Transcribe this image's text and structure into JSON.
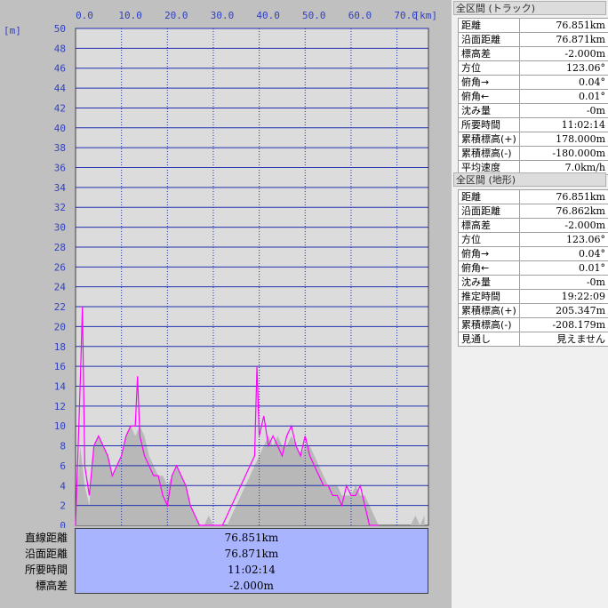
{
  "chart_data": {
    "type": "area",
    "x_unit": "[km]",
    "y_unit": "[m]",
    "x_ticks": [
      "0.0",
      "10.0",
      "20.0",
      "30.0",
      "40.0",
      "50.0",
      "60.0",
      "70.0"
    ],
    "y_ticks": [
      "0",
      "2",
      "4",
      "6",
      "8",
      "10",
      "12",
      "14",
      "16",
      "18",
      "20",
      "22",
      "24",
      "26",
      "28",
      "30",
      "32",
      "34",
      "36",
      "38",
      "40",
      "42",
      "44",
      "46",
      "48",
      "50"
    ],
    "xlim": [
      0,
      76.851
    ],
    "ylim": [
      0,
      50
    ],
    "grid": true,
    "colors": {
      "terrain": "#b8b8b8",
      "track": "#ff00ff",
      "grid": "#2030b0",
      "plot_bg": "#dcdcdc"
    },
    "series": [
      {
        "x": [
          0,
          1,
          2,
          3,
          4,
          5,
          6,
          7,
          8,
          9,
          10,
          11,
          12,
          13,
          14,
          15,
          16,
          17,
          18,
          19,
          20,
          21,
          22,
          23,
          24,
          25,
          26,
          27,
          28,
          29,
          30,
          31,
          32,
          33,
          34,
          35,
          36,
          37,
          38,
          39,
          40,
          41,
          42,
          43,
          44,
          45,
          46,
          47,
          48,
          49,
          50,
          51,
          52,
          53,
          54,
          55,
          56,
          57,
          58,
          59,
          60,
          61,
          62,
          63,
          64,
          65,
          66,
          67,
          68,
          69,
          70,
          71,
          72,
          73,
          74,
          75,
          76
        ],
        "values": [
          0,
          8,
          4,
          2,
          8,
          9,
          8,
          7,
          5,
          6,
          7,
          9,
          10,
          9,
          10,
          9,
          7,
          6,
          5,
          5,
          4,
          5,
          6,
          5,
          4,
          2,
          1,
          0,
          0,
          1,
          0,
          0,
          0,
          0,
          1,
          2,
          3,
          4,
          5,
          6,
          7,
          8,
          9,
          8,
          9,
          8,
          8,
          9,
          8,
          7,
          8,
          8,
          7,
          6,
          5,
          4,
          4,
          4,
          3,
          3,
          3,
          4,
          3,
          3,
          2,
          1,
          0,
          0,
          0,
          0,
          0,
          0,
          0,
          0,
          1,
          0,
          1
        ]
      },
      {
        "x": [
          0,
          1,
          1.5,
          2,
          3,
          4,
          5,
          6,
          7,
          8,
          9,
          10,
          11,
          12,
          13,
          13.5,
          14,
          15,
          16,
          17,
          18,
          19,
          20,
          21,
          22,
          23,
          24,
          25,
          26,
          27,
          28,
          30,
          31,
          32,
          33,
          34,
          35,
          36,
          37,
          38,
          39,
          39.5,
          40,
          41,
          42,
          43,
          44,
          45,
          46,
          47,
          48,
          49,
          50,
          51,
          52,
          53,
          54,
          55,
          56,
          57,
          58,
          59,
          60,
          61,
          62,
          63,
          64,
          65,
          66
        ],
        "values": [
          0,
          14,
          22,
          6,
          3,
          8,
          9,
          8,
          7,
          5,
          6,
          7,
          9,
          10,
          10,
          15,
          9,
          7,
          6,
          5,
          5,
          3,
          2,
          5,
          6,
          5,
          4,
          2,
          1,
          0,
          0,
          0,
          0,
          0,
          1,
          2,
          3,
          4,
          5,
          6,
          7,
          16,
          9,
          11,
          8,
          9,
          8,
          7,
          9,
          10,
          8,
          7,
          9,
          7,
          6,
          5,
          4,
          4,
          3,
          3,
          2,
          4,
          3,
          3,
          4,
          2,
          0,
          0,
          0
        ]
      }
    ]
  },
  "summary": {
    "rows": [
      {
        "label": "直線距離",
        "value": "76.851km"
      },
      {
        "label": "沿面距離",
        "value": "76.871km"
      },
      {
        "label": "所要時間",
        "value": "11:02:14"
      },
      {
        "label": "標高差",
        "value": "-2.000m"
      }
    ]
  },
  "panel_track": {
    "title": "全区間 (トラック)",
    "rows": [
      {
        "key": "距離",
        "value": "76.851km"
      },
      {
        "key": "沿面距離",
        "value": "76.871km"
      },
      {
        "key": "標高差",
        "value": "-2.000m"
      },
      {
        "key": "方位",
        "value": "123.06°"
      },
      {
        "key": "俯角→",
        "value": "0.04°"
      },
      {
        "key": "俯角←",
        "value": "0.01°"
      },
      {
        "key": "沈み量",
        "value": "-0m"
      },
      {
        "key": "所要時間",
        "value": "11:02:14"
      },
      {
        "key": "累積標高(+)",
        "value": "178.000m"
      },
      {
        "key": "累積標高(-)",
        "value": "-180.000m"
      },
      {
        "key": "平均速度",
        "value": "7.0km/h"
      }
    ]
  },
  "panel_terrain": {
    "title": "全区間 (地形)",
    "rows": [
      {
        "key": "距離",
        "value": "76.851km"
      },
      {
        "key": "沿面距離",
        "value": "76.862km"
      },
      {
        "key": "標高差",
        "value": "-2.000m"
      },
      {
        "key": "方位",
        "value": "123.06°"
      },
      {
        "key": "俯角→",
        "value": "0.04°"
      },
      {
        "key": "俯角←",
        "value": "0.01°"
      },
      {
        "key": "沈み量",
        "value": "-0m"
      },
      {
        "key": "推定時間",
        "value": "19:22:09"
      },
      {
        "key": "累積標高(+)",
        "value": "205.347m"
      },
      {
        "key": "累積標高(-)",
        "value": "-208.179m"
      },
      {
        "key": "見通し",
        "value": "見えません"
      }
    ]
  }
}
